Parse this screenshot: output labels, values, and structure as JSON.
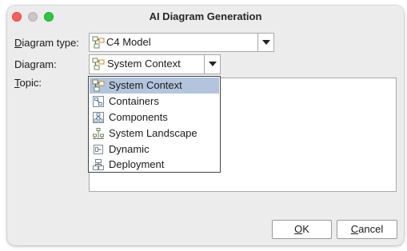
{
  "window": {
    "title": "AI Diagram Generation"
  },
  "form": {
    "diagram_type": {
      "label_mnemonic": "D",
      "label_rest": "iagram type:",
      "value": "C4 Model",
      "icon": "c4-model-icon"
    },
    "diagram": {
      "label": "Diagram:",
      "value": "System Context",
      "icon": "system-context-icon"
    },
    "topic": {
      "label_mnemonic": "T",
      "label_rest": "opic:",
      "value": ""
    }
  },
  "dropdown": {
    "items": [
      {
        "label": "System Context",
        "icon": "system-context-icon",
        "selected": true
      },
      {
        "label": "Containers",
        "icon": "containers-icon",
        "selected": false
      },
      {
        "label": "Components",
        "icon": "components-icon",
        "selected": false
      },
      {
        "label": "System Landscape",
        "icon": "system-landscape-icon",
        "selected": false
      },
      {
        "label": "Dynamic",
        "icon": "dynamic-icon",
        "selected": false
      },
      {
        "label": "Deployment",
        "icon": "deployment-icon",
        "selected": false
      }
    ]
  },
  "buttons": {
    "ok_mnemonic": "O",
    "ok_rest": "K",
    "cancel_mnemonic": "C",
    "cancel_rest": "ancel"
  },
  "colors": {
    "selection": "#b2c5dc",
    "close": "#fe5f57",
    "maximize": "#2bc840"
  }
}
